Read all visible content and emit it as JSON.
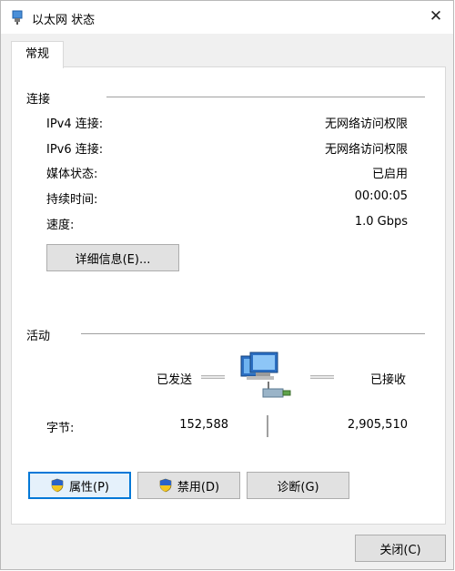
{
  "window": {
    "title": "以太网 状态",
    "icons": {
      "title": "network-adapter-icon",
      "close": "close-icon"
    }
  },
  "tabs": [
    {
      "label": "常规",
      "selected": true
    }
  ],
  "connection": {
    "heading": "连接",
    "rows": [
      {
        "label": "IPv4 连接:",
        "value": "无网络访问权限"
      },
      {
        "label": "IPv6 连接:",
        "value": "无网络访问权限"
      },
      {
        "label": "媒体状态:",
        "value": "已启用"
      },
      {
        "label": "持续时间:",
        "value": "00:00:05"
      },
      {
        "label": "速度:",
        "value": "1.0 Gbps"
      }
    ],
    "details_button": "详细信息(E)..."
  },
  "activity": {
    "heading": "活动",
    "sent_label": "已发送",
    "received_label": "已接收",
    "bytes_label": "字节:",
    "bytes_sent": "152,588",
    "bytes_received": "2,905,510",
    "icon": "network-computers-icon"
  },
  "buttons": {
    "properties": "属性(P)",
    "disable": "禁用(D)",
    "diagnose": "诊断(G)",
    "close": "关闭(C)"
  },
  "colors": {
    "focus": "#0078d7",
    "button_bg": "#e1e1e1",
    "dialog_bg": "#f0f0f0"
  }
}
